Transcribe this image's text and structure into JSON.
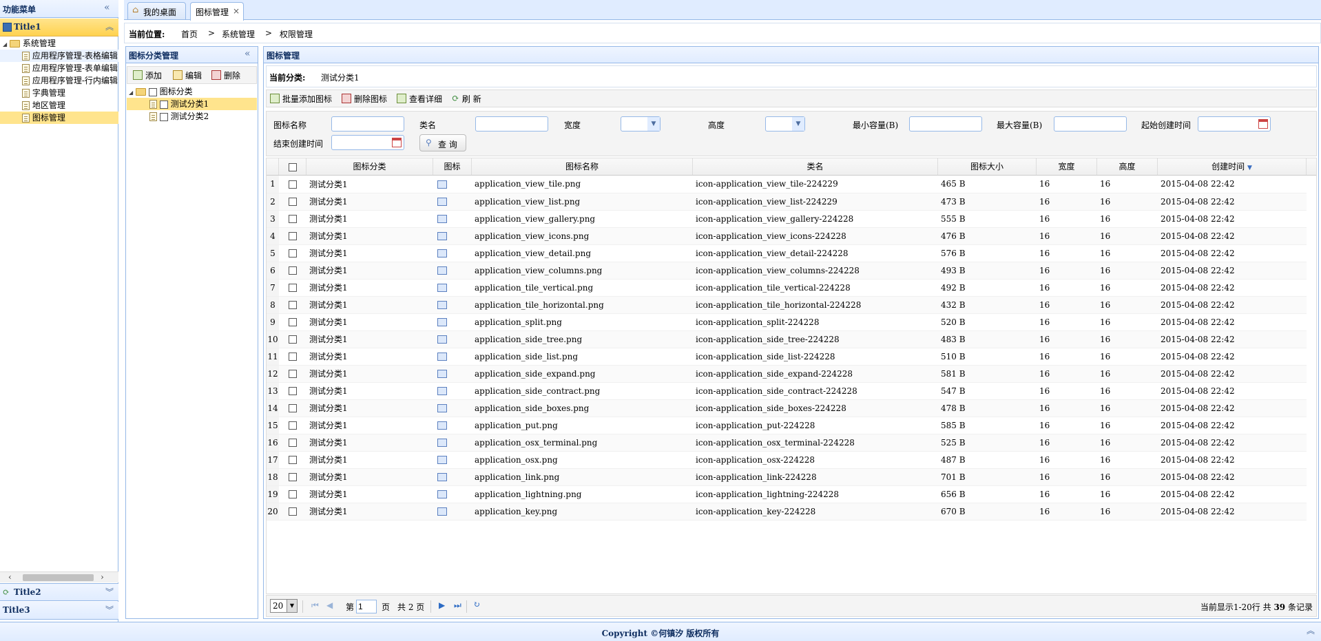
{
  "left_panel": {
    "title": "功能菜单",
    "section1": "Title1",
    "section2": "Title2",
    "section3": "Title3",
    "tree": [
      {
        "label": "系统管理",
        "type": "folder",
        "level": 0
      },
      {
        "label": "应用程序管理-表格编辑",
        "type": "file",
        "level": 1
      },
      {
        "label": "应用程序管理-表单编辑",
        "type": "file",
        "level": 1
      },
      {
        "label": "应用程序管理-行内编辑",
        "type": "file",
        "level": 1
      },
      {
        "label": "字典管理",
        "type": "file",
        "level": 1
      },
      {
        "label": "地区管理",
        "type": "file",
        "level": 1
      },
      {
        "label": "图标管理",
        "type": "file",
        "level": 1,
        "selected": true
      }
    ]
  },
  "tabs": [
    {
      "label": "我的桌面",
      "icon": "home-icon"
    },
    {
      "label": "图标管理",
      "active": true,
      "close": "×"
    }
  ],
  "breadcrumb": {
    "prefix": "当前位置:",
    "items": [
      "首页",
      "系统管理",
      "权限管理"
    ],
    "sep": ">"
  },
  "category_panel": {
    "title": "图标分类管理",
    "add": "添加",
    "edit": "编辑",
    "delete": "删除",
    "root": "图标分类",
    "children": [
      {
        "label": "测试分类1",
        "selected": true
      },
      {
        "label": "测试分类2"
      }
    ]
  },
  "icon_panel": {
    "title": "图标管理",
    "current_label": "当前分类:",
    "current_value": "测试分类1",
    "toolbar": {
      "batch_add": "批量添加图标",
      "delete": "删除图标",
      "view": "查看详细",
      "refresh": "刷 新"
    }
  },
  "filters": {
    "name": "图标名称",
    "class": "类名",
    "width": "宽度",
    "height": "高度",
    "min": "最小容量(B)",
    "max": "最大容量(B)",
    "start": "起始创建时间",
    "end": "结束创建时间",
    "query": "查 询"
  },
  "grid": {
    "headers": [
      "图标分类",
      "图标",
      "图标名称",
      "类名",
      "图标大小",
      "宽度",
      "高度",
      "创建时间"
    ],
    "rows": [
      [
        "测试分类1",
        "application_view_tile.png",
        "icon-application_view_tile-224229",
        "465 B",
        "16",
        "16",
        "2015-04-08 22:42"
      ],
      [
        "测试分类1",
        "application_view_list.png",
        "icon-application_view_list-224229",
        "473 B",
        "16",
        "16",
        "2015-04-08 22:42"
      ],
      [
        "测试分类1",
        "application_view_gallery.png",
        "icon-application_view_gallery-224228",
        "555 B",
        "16",
        "16",
        "2015-04-08 22:42"
      ],
      [
        "测试分类1",
        "application_view_icons.png",
        "icon-application_view_icons-224228",
        "476 B",
        "16",
        "16",
        "2015-04-08 22:42"
      ],
      [
        "测试分类1",
        "application_view_detail.png",
        "icon-application_view_detail-224228",
        "576 B",
        "16",
        "16",
        "2015-04-08 22:42"
      ],
      [
        "测试分类1",
        "application_view_columns.png",
        "icon-application_view_columns-224228",
        "493 B",
        "16",
        "16",
        "2015-04-08 22:42"
      ],
      [
        "测试分类1",
        "application_tile_vertical.png",
        "icon-application_tile_vertical-224228",
        "492 B",
        "16",
        "16",
        "2015-04-08 22:42"
      ],
      [
        "测试分类1",
        "application_tile_horizontal.png",
        "icon-application_tile_horizontal-224228",
        "432 B",
        "16",
        "16",
        "2015-04-08 22:42"
      ],
      [
        "测试分类1",
        "application_split.png",
        "icon-application_split-224228",
        "520 B",
        "16",
        "16",
        "2015-04-08 22:42"
      ],
      [
        "测试分类1",
        "application_side_tree.png",
        "icon-application_side_tree-224228",
        "483 B",
        "16",
        "16",
        "2015-04-08 22:42"
      ],
      [
        "测试分类1",
        "application_side_list.png",
        "icon-application_side_list-224228",
        "510 B",
        "16",
        "16",
        "2015-04-08 22:42"
      ],
      [
        "测试分类1",
        "application_side_expand.png",
        "icon-application_side_expand-224228",
        "581 B",
        "16",
        "16",
        "2015-04-08 22:42"
      ],
      [
        "测试分类1",
        "application_side_contract.png",
        "icon-application_side_contract-224228",
        "547 B",
        "16",
        "16",
        "2015-04-08 22:42"
      ],
      [
        "测试分类1",
        "application_side_boxes.png",
        "icon-application_side_boxes-224228",
        "478 B",
        "16",
        "16",
        "2015-04-08 22:42"
      ],
      [
        "测试分类1",
        "application_put.png",
        "icon-application_put-224228",
        "585 B",
        "16",
        "16",
        "2015-04-08 22:42"
      ],
      [
        "测试分类1",
        "application_osx_terminal.png",
        "icon-application_osx_terminal-224228",
        "525 B",
        "16",
        "16",
        "2015-04-08 22:42"
      ],
      [
        "测试分类1",
        "application_osx.png",
        "icon-application_osx-224228",
        "487 B",
        "16",
        "16",
        "2015-04-08 22:42"
      ],
      [
        "测试分类1",
        "application_link.png",
        "icon-application_link-224228",
        "701 B",
        "16",
        "16",
        "2015-04-08 22:42"
      ],
      [
        "测试分类1",
        "application_lightning.png",
        "icon-application_lightning-224228",
        "656 B",
        "16",
        "16",
        "2015-04-08 22:42"
      ],
      [
        "测试分类1",
        "application_key.png",
        "icon-application_key-224228",
        "670 B",
        "16",
        "16",
        "2015-04-08 22:42"
      ]
    ]
  },
  "pager": {
    "page_size": "20",
    "page_prefix": "第",
    "page": "1",
    "page_mid": "页",
    "total_pages": "共 2 页",
    "info_prefix": "当前显示1-20行 共",
    "info_count": "39",
    "info_suffix": "条记录"
  },
  "footer": "Copyright ©何镇汐 版权所有"
}
